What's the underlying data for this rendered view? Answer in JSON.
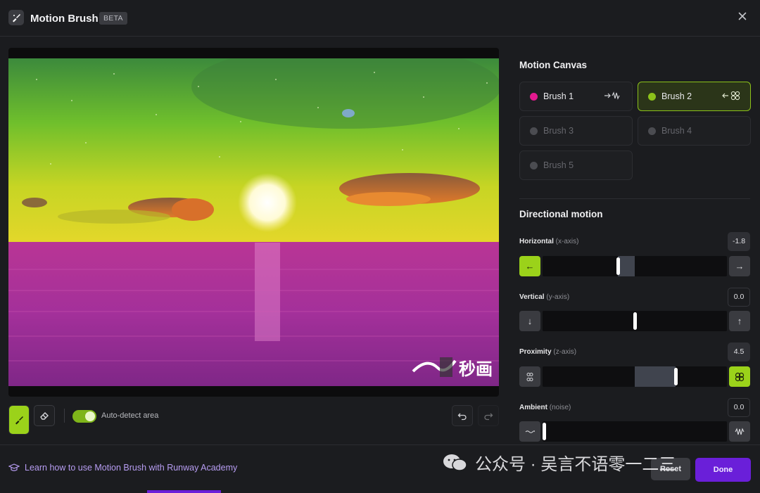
{
  "header": {
    "title": "Motion Brush",
    "badge": "BETA",
    "close_icon": "close-icon"
  },
  "canvas": {
    "image_overlay_text": "秒画"
  },
  "toolbar": {
    "toggle_label": "Auto-detect area",
    "auto_detect_on": true
  },
  "motion_canvas": {
    "title": "Motion Canvas",
    "brushes": [
      {
        "label": "Brush 1",
        "color": "#e3198f",
        "state": "default",
        "icon": "horizontal-wave-icon"
      },
      {
        "label": "Brush 2",
        "color": "#8cc21a",
        "state": "selected",
        "icon": "proximity-icon"
      },
      {
        "label": "Brush 3",
        "state": "disabled"
      },
      {
        "label": "Brush 4",
        "state": "disabled"
      },
      {
        "label": "Brush 5",
        "state": "disabled"
      }
    ]
  },
  "directional_motion": {
    "title": "Directional motion",
    "controls": [
      {
        "label": "Horizontal",
        "sub": "(x-axis)",
        "value": "-1.8"
      },
      {
        "label": "Vertical",
        "sub": "(y-axis)",
        "value": "0.0"
      },
      {
        "label": "Proximity",
        "sub": "(z-axis)",
        "value": "4.5"
      },
      {
        "label": "Ambient",
        "sub": "(noise)",
        "value": "0.0"
      }
    ]
  },
  "footer": {
    "academy_link": "Learn how to use Motion Brush with Runway Academy",
    "reset_label": "Reset",
    "done_label": "Done"
  },
  "watermark": {
    "text": "公众号 · 吴言不语零一二三"
  },
  "colors": {
    "accent_green": "#9bd21a",
    "accent_purple": "#6a1fd9",
    "brush1": "#e3198f",
    "brush2": "#8cc21a"
  }
}
